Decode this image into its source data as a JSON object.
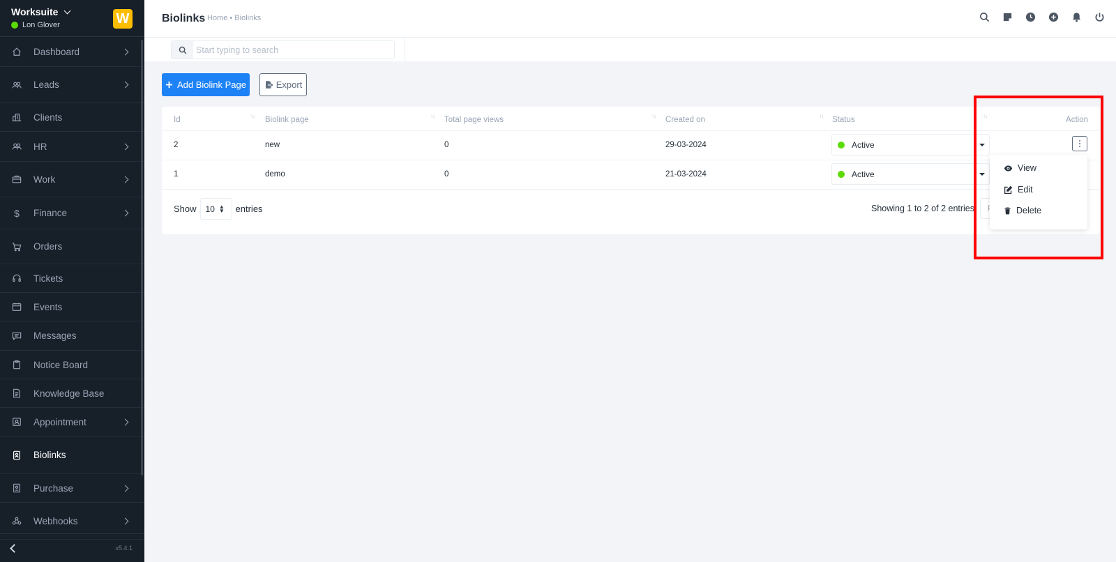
{
  "app": {
    "name": "Worksuite",
    "user": "Lon Glover",
    "logo_letter": "W",
    "version": "v5.4.1",
    "status_color": "#5cdb05"
  },
  "sidebar": {
    "items": [
      {
        "label": "Dashboard",
        "icon": "home-icon",
        "has_submenu": true
      },
      {
        "label": "Leads",
        "icon": "users-icon",
        "has_submenu": true
      },
      {
        "label": "Clients",
        "icon": "building-icon",
        "has_submenu": false
      },
      {
        "label": "HR",
        "icon": "people-icon",
        "has_submenu": true
      },
      {
        "label": "Work",
        "icon": "briefcase-icon",
        "has_submenu": true
      },
      {
        "label": "Finance",
        "icon": "dollar-icon",
        "has_submenu": true
      },
      {
        "label": "Orders",
        "icon": "cart-icon",
        "has_submenu": false
      },
      {
        "label": "Tickets",
        "icon": "headset-icon",
        "has_submenu": false
      },
      {
        "label": "Events",
        "icon": "calendar-icon",
        "has_submenu": false
      },
      {
        "label": "Messages",
        "icon": "chat-icon",
        "has_submenu": false
      },
      {
        "label": "Notice Board",
        "icon": "clipboard-icon",
        "has_submenu": false
      },
      {
        "label": "Knowledge Base",
        "icon": "document-icon",
        "has_submenu": false
      },
      {
        "label": "Appointment",
        "icon": "contact-icon",
        "has_submenu": true
      },
      {
        "label": "Biolinks",
        "icon": "biolink-icon",
        "has_submenu": false,
        "active": true
      },
      {
        "label": "Purchase",
        "icon": "receipt-icon",
        "has_submenu": true
      },
      {
        "label": "Webhooks",
        "icon": "webhook-icon",
        "has_submenu": true
      }
    ]
  },
  "header": {
    "title": "Biolinks",
    "breadcrumb": "Home • Biolinks",
    "icons": [
      "search-icon",
      "sticky-note-icon",
      "clock-icon",
      "plus-circle-icon",
      "bell-icon",
      "power-icon"
    ]
  },
  "search": {
    "placeholder": "Start typing to search"
  },
  "toolbar": {
    "add_label": "Add Biolink Page",
    "export_label": "Export"
  },
  "table": {
    "columns": [
      "Id",
      "Biolink page",
      "Total page views",
      "Created on",
      "Status",
      "Action"
    ],
    "rows": [
      {
        "id": "2",
        "page": "new",
        "views": "0",
        "created": "29-03-2024",
        "status": "Active"
      },
      {
        "id": "1",
        "page": "demo",
        "views": "0",
        "created": "21-03-2024",
        "status": "Active"
      }
    ],
    "length_label_pre": "Show",
    "length_value": "10",
    "length_label_post": "entries",
    "info": "Showing 1 to 2 of 2 entries",
    "pagination_partial": "P"
  },
  "action_menu": {
    "items": [
      {
        "label": "View",
        "icon": "eye-icon"
      },
      {
        "label": "Edit",
        "icon": "edit-icon"
      },
      {
        "label": "Delete",
        "icon": "trash-icon"
      }
    ]
  },
  "colors": {
    "primary": "#1d82f5",
    "sidebar_bg": "#171f29",
    "active_dot": "#5cdb05",
    "highlight": "#ff0000"
  }
}
